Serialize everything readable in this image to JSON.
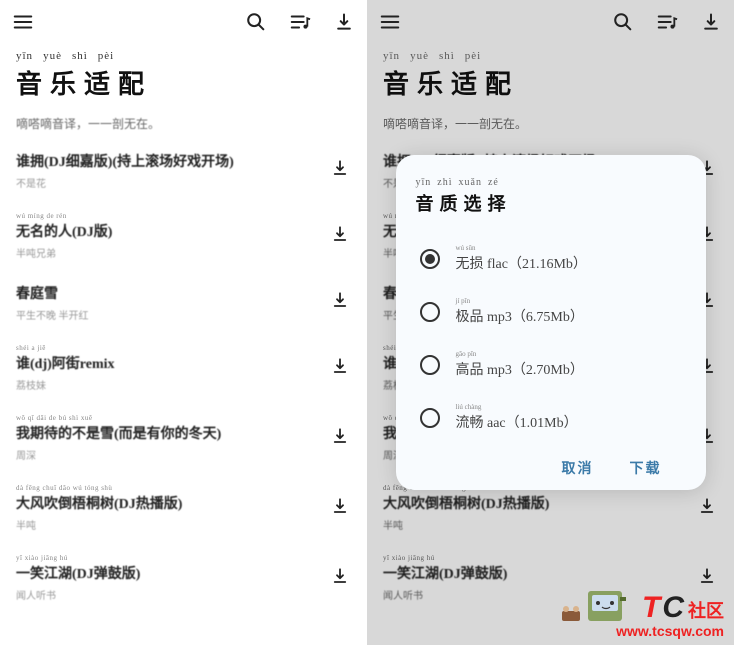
{
  "app": {
    "title_pinyin": [
      "yīn",
      "yuè",
      "shì",
      "pèi"
    ],
    "title_hanzi": "音乐适配",
    "subtitle": "嘀嗒嘀音译，一一剖无在。"
  },
  "songs": [
    {
      "pinyin": "",
      "title": "谁拥(DJ细嘉版)(持上滚场好戏开场)",
      "artist": "不是花"
    },
    {
      "pinyin": "wú míng de rén",
      "title": "无名的人(DJ版)",
      "artist": "半吨兄弟"
    },
    {
      "pinyin": "",
      "title": "春庭雪",
      "artist": "平生不晚 半开红"
    },
    {
      "pinyin": "shéi  a jiē",
      "title": "谁(dj)阿街remix",
      "artist": "荔枝妹"
    },
    {
      "pinyin": "wǒ qī dāi de bú shì xuě",
      "title": "我期待的不是雪(而是有你的冬天)",
      "artist": "周深"
    },
    {
      "pinyin": "dà fēng chuī dǎo wú tóng shù",
      "title": "大风吹倒梧桐树(DJ热播版)",
      "artist": "半吨"
    },
    {
      "pinyin": "yī xiào jiāng hú",
      "title": "一笑江湖(DJ弹鼓版)",
      "artist": "闻人听书"
    }
  ],
  "dialog": {
    "title_pinyin": [
      "yīn",
      "zhì",
      "xuǎn",
      "zé"
    ],
    "title_hanzi": "音质选择",
    "options": [
      {
        "py": "wú sǔn",
        "label": "无损 flac（21.16Mb）",
        "checked": true
      },
      {
        "py": "jí pǐn",
        "label": "极品 mp3（6.75Mb）",
        "checked": false
      },
      {
        "py": "gāo pǐn",
        "label": "高品 mp3（2.70Mb）",
        "checked": false
      },
      {
        "py": "liú chàng",
        "label": "流畅 aac（1.01Mb）",
        "checked": false
      }
    ],
    "cancel": "取消",
    "confirm": "下载"
  },
  "watermark": {
    "t": "T",
    "c": "C",
    "sq": "社区",
    "url": "www.tcsqw.com"
  }
}
